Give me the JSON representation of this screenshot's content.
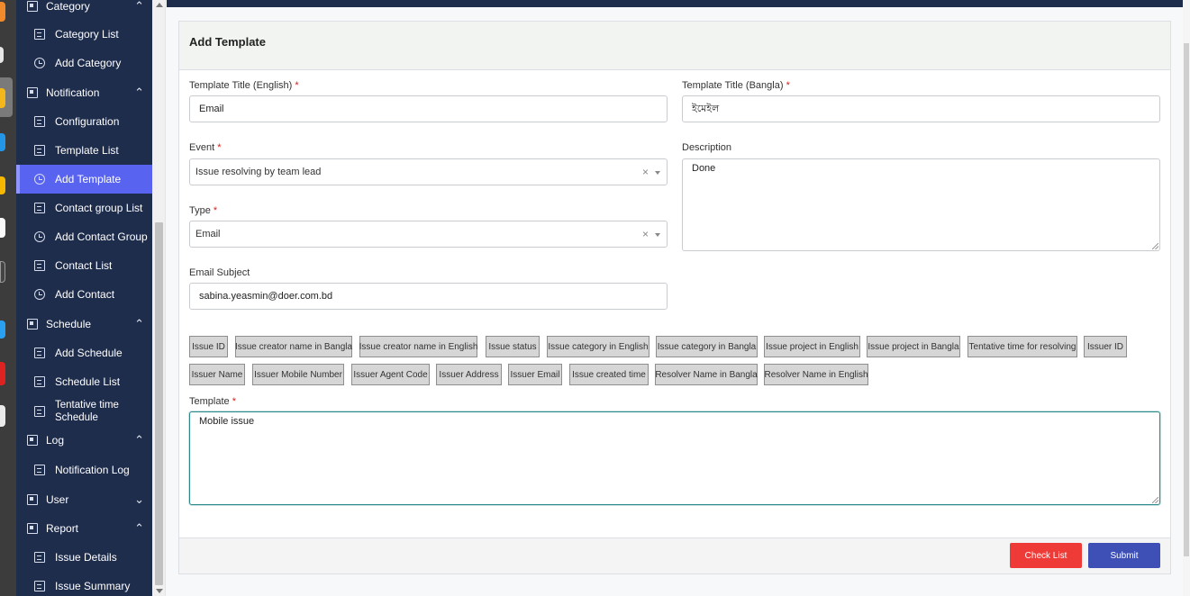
{
  "sidebar": {
    "items": [
      {
        "label": "Category",
        "kind": "group",
        "icon": "group-icon",
        "chevron": "up"
      },
      {
        "label": "Category List",
        "kind": "sub",
        "icon": "doc-icon"
      },
      {
        "label": "Add Category",
        "kind": "sub",
        "icon": "history-icon"
      },
      {
        "label": "Notification",
        "kind": "group",
        "icon": "group-icon",
        "chevron": "up"
      },
      {
        "label": "Configuration",
        "kind": "sub",
        "icon": "doc-icon"
      },
      {
        "label": "Template List",
        "kind": "sub",
        "icon": "doc-icon"
      },
      {
        "label": "Add Template",
        "kind": "sub",
        "icon": "history-icon",
        "active": true
      },
      {
        "label": "Contact group List",
        "kind": "sub",
        "icon": "doc-icon"
      },
      {
        "label": "Add Contact Group",
        "kind": "sub",
        "icon": "history-icon"
      },
      {
        "label": "Contact List",
        "kind": "sub",
        "icon": "doc-icon"
      },
      {
        "label": "Add Contact",
        "kind": "sub",
        "icon": "history-icon"
      },
      {
        "label": "Schedule",
        "kind": "group",
        "icon": "group-icon",
        "chevron": "up"
      },
      {
        "label": "Add Schedule",
        "kind": "sub",
        "icon": "doc-icon"
      },
      {
        "label": "Schedule List",
        "kind": "sub",
        "icon": "doc-icon"
      },
      {
        "label": "Tentative time Schedule",
        "kind": "sub",
        "icon": "doc-icon"
      },
      {
        "label": "Log",
        "kind": "group",
        "icon": "group-icon",
        "chevron": "up"
      },
      {
        "label": "Notification Log",
        "kind": "sub",
        "icon": "doc-icon"
      },
      {
        "label": "User",
        "kind": "group",
        "icon": "group-icon",
        "chevron": "down"
      },
      {
        "label": "Report",
        "kind": "group",
        "icon": "chart-icon",
        "chevron": "up"
      },
      {
        "label": "Issue Details",
        "kind": "sub",
        "icon": "doc-icon"
      },
      {
        "label": "Issue Summary",
        "kind": "sub",
        "icon": "doc-icon"
      }
    ]
  },
  "form": {
    "title": "Add Template",
    "title_en_label": "Template Title (English)",
    "title_en_value": "Email",
    "title_bn_label": "Template Title (Bangla)",
    "title_bn_value": "ইমেইল",
    "event_label": "Event",
    "event_value": "Issue resolving by team lead",
    "description_label": "Description",
    "description_value": "Done",
    "type_label": "Type",
    "type_value": "Email",
    "subject_label": "Email Subject",
    "subject_value": "sabina.yeasmin@doer.com.bd",
    "template_label": "Template",
    "template_value": "Mobile issue",
    "required_mark": "*",
    "clear_glyph": "×"
  },
  "chips": [
    "Issue ID",
    "Issue creator name in Bangla",
    "Issue creator name in English",
    "Issue status",
    "Issue category in English",
    "Issue category in Bangla",
    "Issue project in English",
    "Issue project in Bangla",
    "Tentative time for resolving",
    "Issuer ID",
    "Issuer Name",
    "Issuer Mobile Number",
    "Issuer Agent Code",
    "Issuer Address",
    "Issuer Email",
    "Issue created time",
    "Resolver Name in Bangla",
    "Resolver Name in English"
  ],
  "buttons": {
    "check_list": "Check List",
    "submit": "Submit"
  },
  "colors": {
    "sidebar_bg": "#1f2d4d",
    "active_item": "#5863f0",
    "check_list_btn": "#ef3b38",
    "submit_btn": "#3e4fb5"
  }
}
